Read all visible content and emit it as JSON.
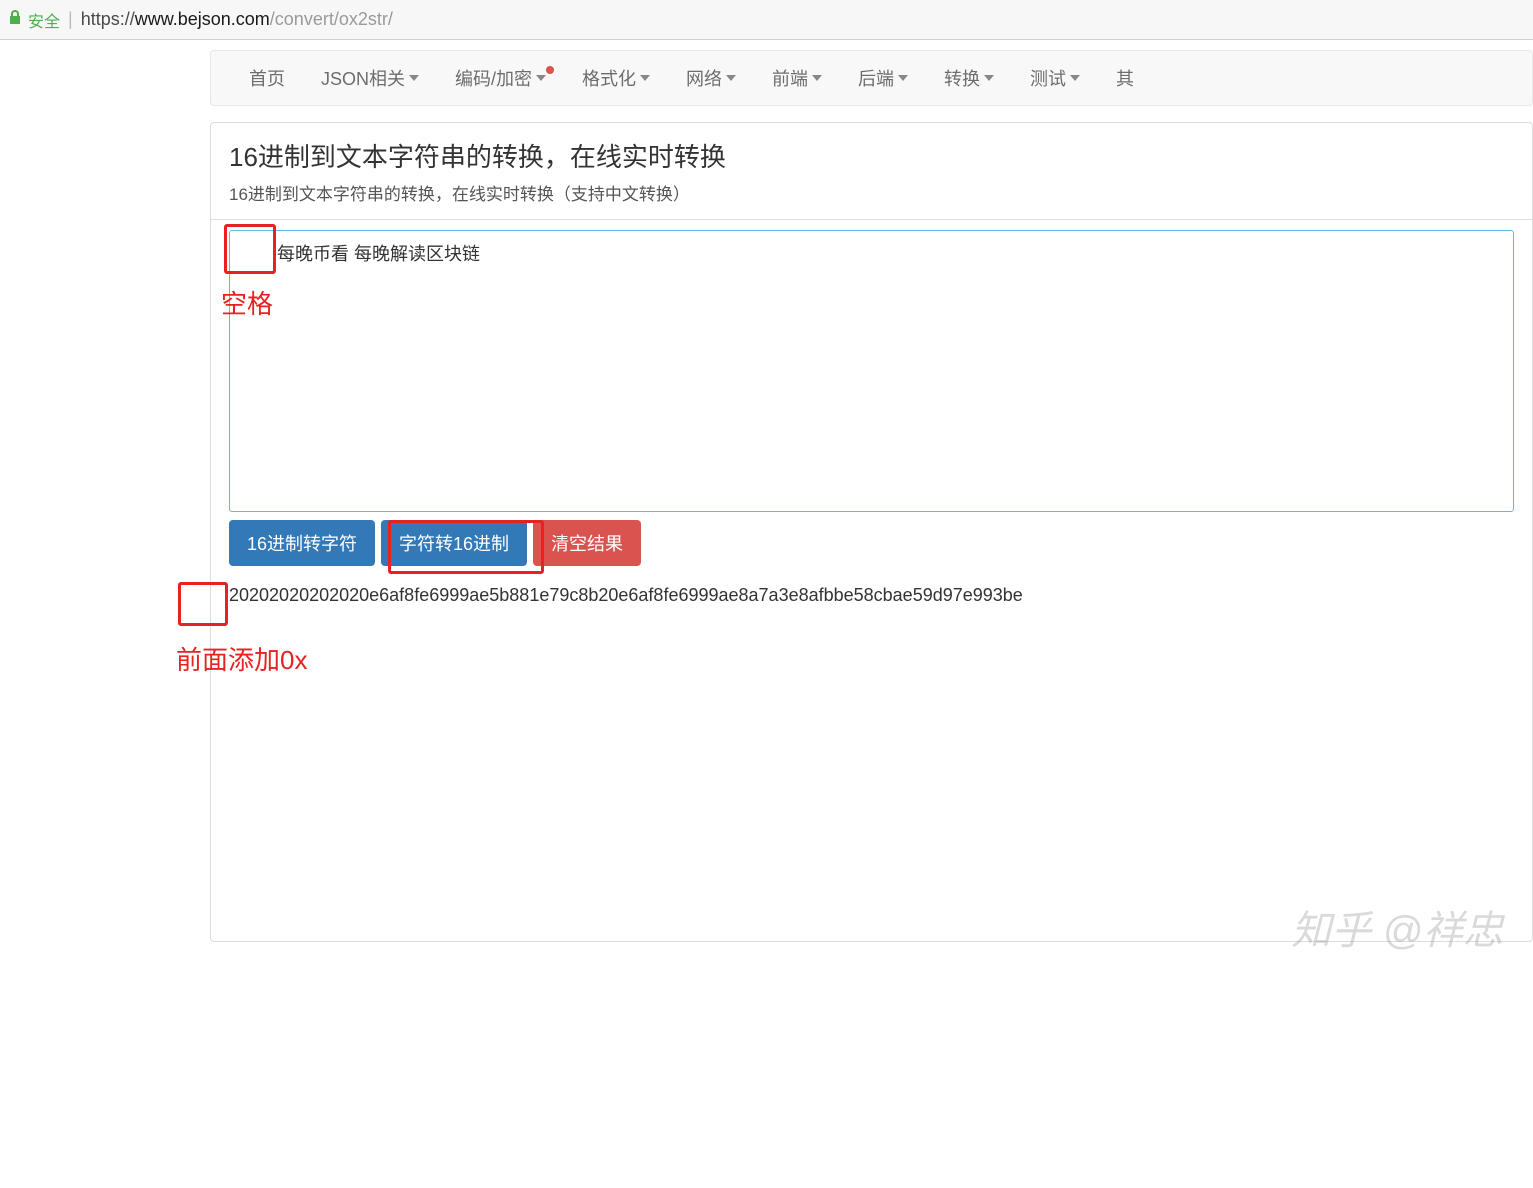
{
  "browser": {
    "secure_label": "安全",
    "url_proto": "https://",
    "url_host": "www.bejson.com",
    "url_path": "/convert/ox2str/"
  },
  "nav": {
    "items": [
      {
        "label": "首页",
        "dropdown": false,
        "dot": false
      },
      {
        "label": "JSON相关",
        "dropdown": true,
        "dot": false
      },
      {
        "label": "编码/加密",
        "dropdown": true,
        "dot": true
      },
      {
        "label": "格式化",
        "dropdown": true,
        "dot": false
      },
      {
        "label": "网络",
        "dropdown": true,
        "dot": false
      },
      {
        "label": "前端",
        "dropdown": true,
        "dot": false
      },
      {
        "label": "后端",
        "dropdown": true,
        "dot": false
      },
      {
        "label": "转换",
        "dropdown": true,
        "dot": false
      },
      {
        "label": "测试",
        "dropdown": true,
        "dot": false
      },
      {
        "label": "其",
        "dropdown": false,
        "dot": false
      }
    ]
  },
  "header": {
    "title": "16进制到文本字符串的转换，在线实时转换",
    "subtitle": "16进制到文本字符串的转换，在线实时转换（支持中文转换）"
  },
  "input": {
    "value": "       每晚币看 每晚解读区块链"
  },
  "buttons": {
    "hex_to_str": "16进制转字符",
    "str_to_hex": "字符转16进制",
    "clear": "清空结果"
  },
  "output": {
    "value": "20202020202020e6af8fe6999ae5b881e79c8b20e6af8fe6999ae8a7a3e8afbbe58cbae59d97e993be"
  },
  "annotations": {
    "box1_label": "空格",
    "box2_label": "前面添加0x"
  },
  "watermark": "知乎 @祥忠"
}
